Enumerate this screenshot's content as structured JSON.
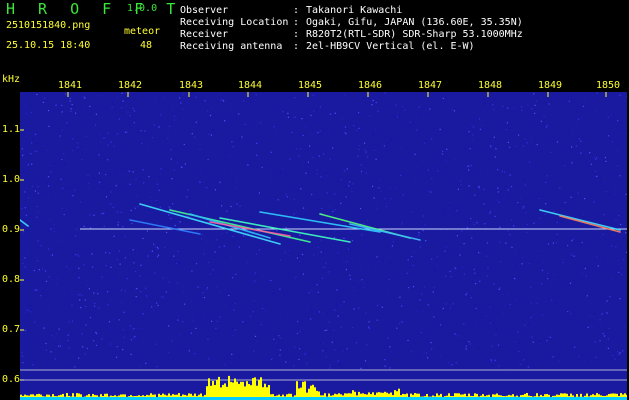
{
  "app": {
    "name": "H R O F F T",
    "version": "1.0.0"
  },
  "file": {
    "name": "2510151840.png",
    "datetime": "25.10.15 18:40"
  },
  "meteor": {
    "label": "meteor",
    "count": "48"
  },
  "info": [
    {
      "key": "Observer",
      "sep": ":",
      "value": "Takanori Kawachi"
    },
    {
      "key": "Receiving Location",
      "sep": ":",
      "value": "Ogaki, Gifu, JAPAN (136.60E, 35.35N)"
    },
    {
      "key": "Receiver",
      "sep": ":",
      "value": "R820T2(RTL-SDR) SDR-Sharp 53.1000MHz"
    },
    {
      "key": "Receiving antenna",
      "sep": ":",
      "value": "2el-HB9CV Vertical (el. E-W)"
    }
  ],
  "colors": {
    "accent": "#39e639",
    "label": "#ffff33",
    "text": "#ffffff",
    "background": "#1a1aa0",
    "activity": "#ffff00",
    "baseline": "#00ccff"
  },
  "chart_data": {
    "type": "heatmap",
    "ylabel": "kHz",
    "y_ticks": [
      "1.1",
      "1.0",
      "0.9",
      "0.8",
      "0.7",
      "0.6"
    ],
    "x_ticks": [
      "1841",
      "1842",
      "1843",
      "1844",
      "1845",
      "1846",
      "1847",
      "1848",
      "1849",
      "1850"
    ],
    "carrier_khz": 0.9
  }
}
